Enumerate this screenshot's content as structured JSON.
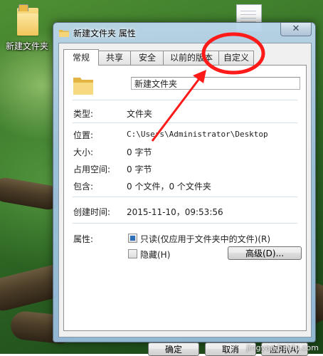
{
  "desktop": {
    "folder_label": "新建文件夹"
  },
  "dialog": {
    "title": "新建文件夹 属性",
    "close_glyph": "✕",
    "tabs": [
      {
        "label": "常规",
        "active": true
      },
      {
        "label": "共享",
        "active": false
      },
      {
        "label": "安全",
        "active": false
      },
      {
        "label": "以前的版本",
        "active": false
      },
      {
        "label": "自定义",
        "active": false
      }
    ],
    "name_value": "新建文件夹",
    "props": {
      "type_label": "类型:",
      "type_value": "文件夹",
      "location_label": "位置:",
      "location_value": "C:\\Users\\Administrator\\Desktop",
      "size_label": "大小:",
      "size_value": "0 字节",
      "disk_label": "占用空间:",
      "disk_value": "0 字节",
      "contains_label": "包含:",
      "contains_value": "0 个文件，0 个文件夹",
      "created_label": "创建时间:",
      "created_value": "2015-11-10，09:53:56",
      "attr_label": "属性:",
      "readonly_label": "只读(仅应用于文件夹中的文件)(R)",
      "readonly_checked": true,
      "hidden_label": "隐藏(H)",
      "hidden_checked": false,
      "advanced_button": "高级(D)..."
    },
    "buttons": {
      "ok": "确定",
      "cancel": "取消",
      "apply": "应用(A)"
    }
  },
  "annotation": {
    "color": "#ff1a1a"
  },
  "watermark": "jingyan.baidu.com"
}
